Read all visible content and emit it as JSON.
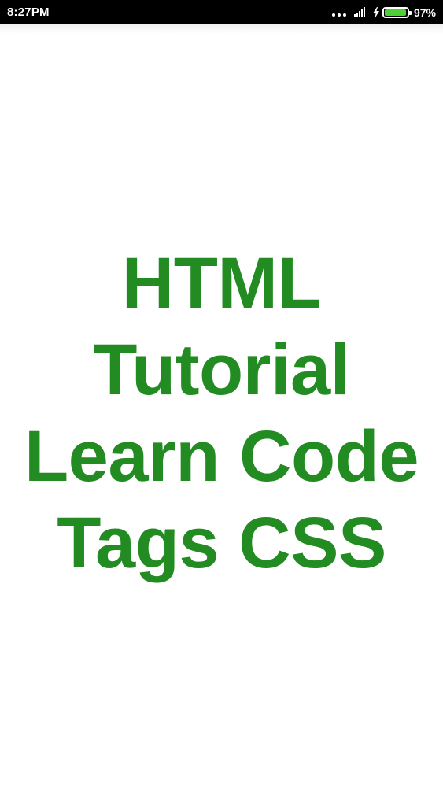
{
  "status_bar": {
    "time": "8:27PM",
    "battery_percent": "97%",
    "battery_level": 0.97,
    "battery_color": "#4cd137",
    "icons": [
      "more-dots-icon",
      "signal-icon",
      "charging-bolt-icon",
      "battery-icon"
    ]
  },
  "splash": {
    "text_color": "#228b22",
    "lines": [
      "HTML",
      "Tutorial",
      "Learn Code",
      "Tags CSS"
    ]
  }
}
